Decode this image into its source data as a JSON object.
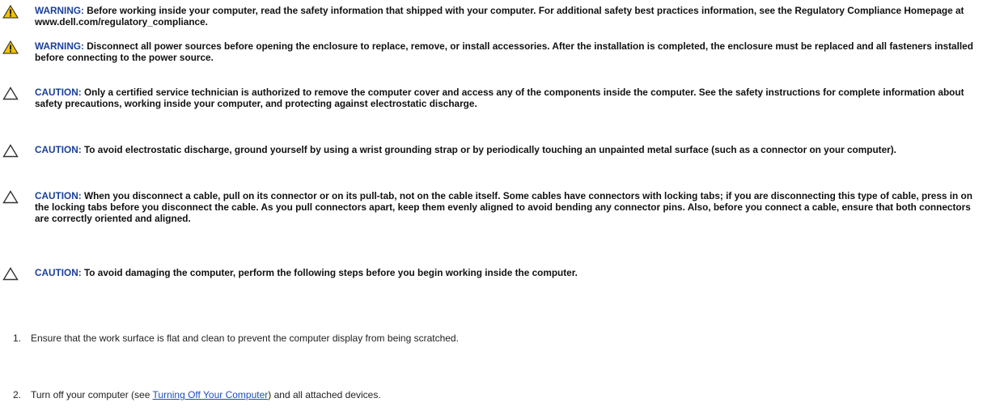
{
  "notices": [
    {
      "type": "warning",
      "icon": "warning-icon",
      "label": "WARNING:",
      "text": " Before working inside your computer, read the safety information that shipped with your computer. For additional safety best practices information, see the Regulatory Compliance Homepage at www.dell.com/regulatory_compliance."
    },
    {
      "type": "warning",
      "icon": "warning-icon",
      "label": "WARNING:",
      "text": " Disconnect all power sources before opening the enclosure to replace, remove, or install accessories. After the installation is completed, the enclosure must be replaced and all fasteners installed before connecting to the power source."
    },
    {
      "type": "caution",
      "icon": "caution-icon",
      "label": "CAUTION:",
      "text": " Only a certified service technician is authorized to remove the computer cover and access any of the components inside the computer. See the safety instructions for complete information about safety precautions, working inside your computer, and protecting against electrostatic discharge."
    },
    {
      "type": "caution",
      "icon": "caution-icon",
      "label": "CAUTION:",
      "text": " To avoid electrostatic discharge, ground yourself by using a wrist grounding strap or by periodically touching an unpainted metal surface (such as a connector on your computer)."
    },
    {
      "type": "caution",
      "icon": "caution-icon",
      "label": "CAUTION:",
      "text": " When you disconnect a cable, pull on its connector or on its pull-tab, not on the cable itself. Some cables have connectors with locking tabs; if you are disconnecting this type of cable, press in on the locking tabs before you disconnect the cable. As you pull connectors apart, keep them evenly aligned to avoid bending any connector pins. Also, before you connect a cable, ensure that both connectors are correctly oriented and aligned."
    },
    {
      "type": "caution",
      "icon": "caution-icon",
      "label": "CAUTION:",
      "text": " To avoid damaging the computer, perform the following steps before you begin working inside the computer."
    }
  ],
  "steps": [
    {
      "number": "1.",
      "text": "Ensure that the work surface is flat and clean to prevent the computer display from being scratched."
    },
    {
      "number": "2.",
      "text_before": "Turn off your computer (see ",
      "link_text": "Turning Off Your Computer",
      "text_after": ") and all attached devices."
    }
  ],
  "colors": {
    "label": "#1a3f99",
    "link": "#1e4fb8",
    "warning_icon_fill": "#f2c200",
    "caution_icon_stroke": "#333333"
  }
}
